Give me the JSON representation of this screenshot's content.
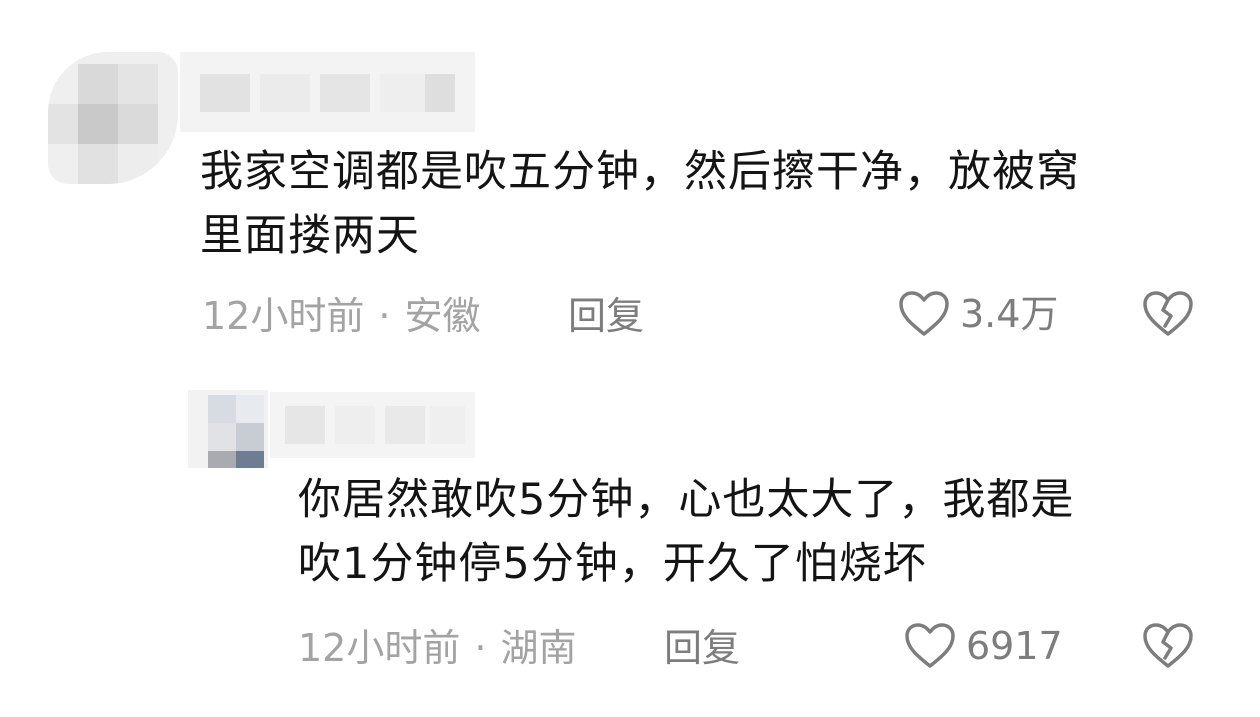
{
  "comments": [
    {
      "text": "我家空调都是吹五分钟，然后擦干净，放被窝\n里面搂两天",
      "time": "12小时前",
      "location": "安徽",
      "reply_label": "回复",
      "like_count": "3.4万",
      "icons": {
        "like": "heart-outline-icon",
        "dislike": "broken-heart-icon"
      }
    },
    {
      "text": "你居然敢吹5分钟，心也太大了，我都是\n吹1分钟停5分钟，开久了怕烧坏",
      "time": "12小时前",
      "location": "湖南",
      "reply_label": "回复",
      "like_count": "6917",
      "icons": {
        "like": "heart-outline-icon",
        "dislike": "broken-heart-icon"
      }
    }
  ],
  "separator": "·",
  "colors": {
    "text": "#141414",
    "meta": "#a3a3a3",
    "action": "#7d7d7d"
  }
}
